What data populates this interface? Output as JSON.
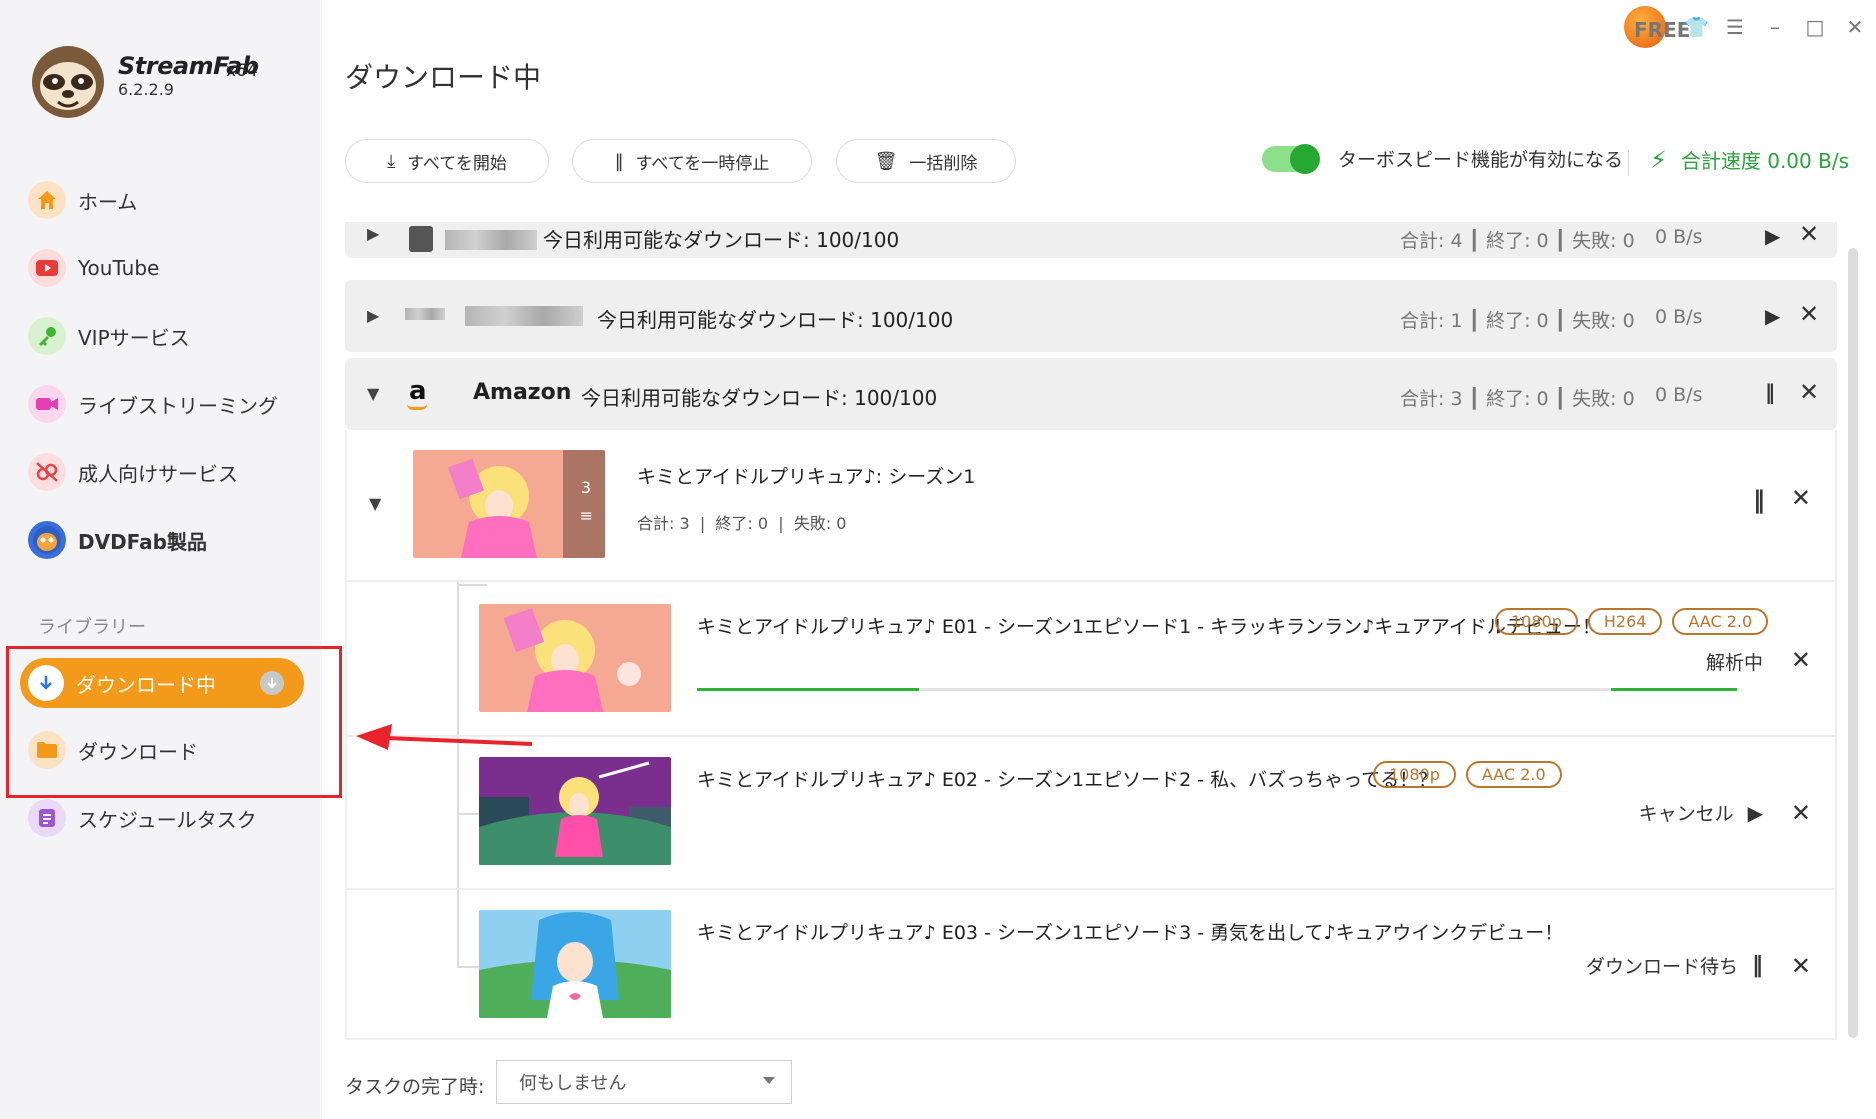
{
  "app": {
    "brand": "StreamFab",
    "arch": "x64",
    "version": "6.2.2.9",
    "free_badge": "FREE"
  },
  "sidebar": {
    "items": [
      {
        "label": "ホーム",
        "icon": "home-icon"
      },
      {
        "label": "YouTube",
        "icon": "youtube-icon"
      },
      {
        "label": "VIPサービス",
        "icon": "key-icon"
      },
      {
        "label": "ライブストリーミング",
        "icon": "camera-icon"
      },
      {
        "label": "成人向けサービス",
        "icon": "adult-icon"
      },
      {
        "label": "DVDFab製品",
        "icon": "dvdfab-icon"
      }
    ],
    "library_title": "ライブラリー",
    "library": [
      {
        "label": "ダウンロード中",
        "icon": "download-arrow-icon",
        "active": true
      },
      {
        "label": "ダウンロード",
        "icon": "folder-icon"
      },
      {
        "label": "スケジュールタスク",
        "icon": "schedule-icon"
      }
    ]
  },
  "main": {
    "title": "ダウンロード中",
    "buttons": {
      "start_all": "すべてを開始",
      "pause_all": "すべてを一時停止",
      "delete_all": "一括削除"
    },
    "turbo_label": "ターボスピード機能が有効になる",
    "turbo_on": true,
    "total_speed": "合計速度 0.00 B/s"
  },
  "groups": [
    {
      "quota": "今日利用可能なダウンロード: 100/100",
      "total": "合計: 4",
      "done": "終了: 0",
      "failed": "失敗: 0",
      "speed": "0 B/s",
      "expanded": false
    },
    {
      "quota": "今日利用可能なダウンロード: 100/100",
      "total": "合計: 1",
      "done": "終了: 0",
      "failed": "失敗: 0",
      "speed": "0 B/s",
      "expanded": false
    },
    {
      "name": "Amazon",
      "quota": "今日利用可能なダウンロード: 100/100",
      "total": "合計: 3",
      "done": "終了: 0",
      "failed": "失敗: 0",
      "speed": "0 B/s",
      "expanded": true
    }
  ],
  "series": {
    "title": "キミとアイドルプリキュア♪: シーズン1",
    "total": "合計: 3",
    "done": "終了: 0",
    "failed": "失敗: 0",
    "thumb_count": "3"
  },
  "episodes": [
    {
      "title": "キミとアイドルプリキュア♪ E01 - シーズン1エピソード1 - キラッキランラン♪キュアアイドルデビュー！",
      "tags": [
        "1080p",
        "H264",
        "AAC 2.0"
      ],
      "status": "解析中"
    },
    {
      "title": "キミとアイドルプリキュア♪ E02 - シーズン1エピソード2 - 私、バズっちゃってる！？",
      "tags": [
        "1080p",
        "AAC 2.0"
      ],
      "status": "キャンセル"
    },
    {
      "title": "キミとアイドルプリキュア♪ E03 - シーズン1エピソード3 - 勇気を出して♪キュアウインクデビュー！",
      "tags": [],
      "status": "ダウンロード待ち"
    }
  ],
  "footer": {
    "label": "タスクの完了時:",
    "selected": "何もしません"
  },
  "colors": {
    "accent": "#f39a1a",
    "turbo": "#27a832",
    "tag": "#b9762f",
    "highlight": "#e8232c"
  }
}
